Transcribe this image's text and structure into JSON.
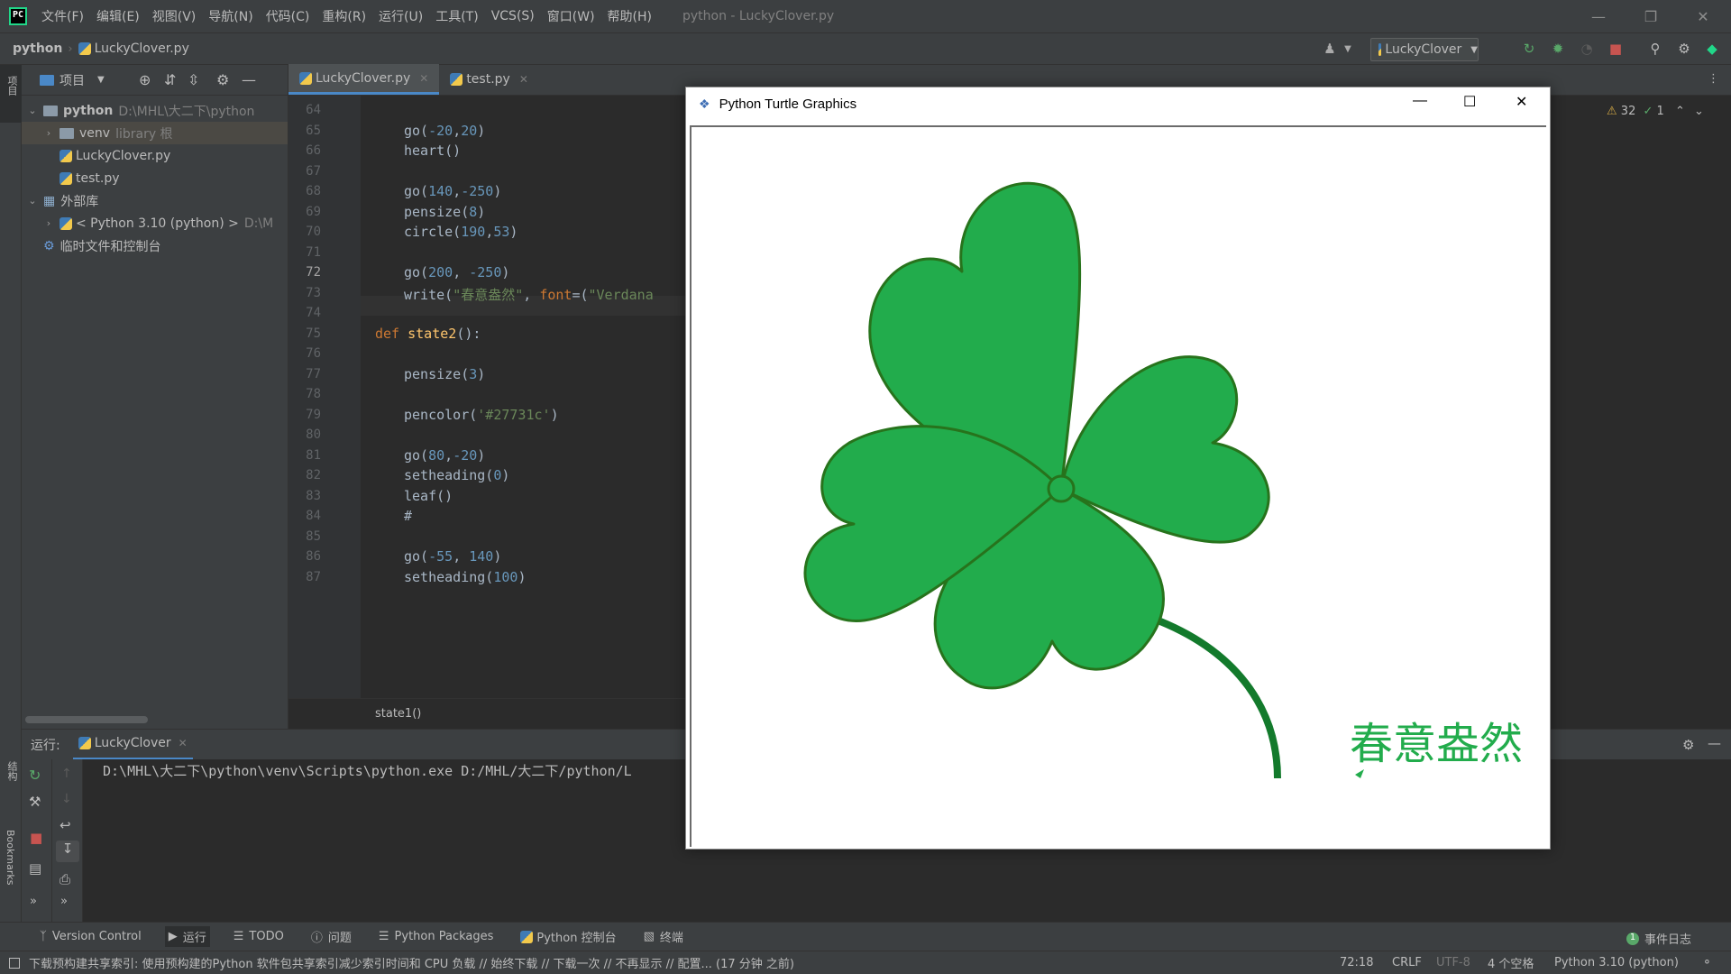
{
  "menubar": {
    "items": [
      "文件(F)",
      "编辑(E)",
      "视图(V)",
      "导航(N)",
      "代码(C)",
      "重构(R)",
      "运行(U)",
      "工具(T)",
      "VCS(S)",
      "窗口(W)",
      "帮助(H)"
    ],
    "window_title": "python - LuckyClover.py"
  },
  "navbar": {
    "project": "python",
    "file": "LuckyClover.py",
    "run_config": "LuckyClover"
  },
  "project_panel": {
    "title": "项目",
    "root": "python",
    "root_path": "D:\\MHL\\大二下\\python",
    "venv": "venv",
    "venv_note": "library 根",
    "file1": "LuckyClover.py",
    "file2": "test.py",
    "external_libs": "外部库",
    "python_sdk": "< Python 3.10 (python) >",
    "python_sdk_path": "D:\\M",
    "scratches": "临时文件和控制台"
  },
  "editor": {
    "tabs": [
      "LuckyClover.py",
      "test.py"
    ],
    "breadcrumb": "state1()",
    "inspections": {
      "warnings": "32",
      "ok": "1"
    },
    "lines": [
      {
        "n": "64",
        "code": ""
      },
      {
        "n": "65",
        "code": "go(-20,20)"
      },
      {
        "n": "66",
        "code": "heart()"
      },
      {
        "n": "67",
        "code": ""
      },
      {
        "n": "68",
        "code": "go(140,-250)"
      },
      {
        "n": "69",
        "code": "pensize(8)"
      },
      {
        "n": "70",
        "code": "circle(190,53)"
      },
      {
        "n": "71",
        "code": ""
      },
      {
        "n": "72",
        "code": "go(200, -250)"
      },
      {
        "n": "73",
        "code": "write(\"春意盎然\", font=(\"Verdana"
      },
      {
        "n": "74",
        "code": ""
      },
      {
        "n": "75",
        "code": "def state2():"
      },
      {
        "n": "76",
        "code": ""
      },
      {
        "n": "77",
        "code": "pensize(3)"
      },
      {
        "n": "78",
        "code": ""
      },
      {
        "n": "79",
        "code": "pencolor('#27731c')"
      },
      {
        "n": "80",
        "code": ""
      },
      {
        "n": "81",
        "code": "go(80,-20)"
      },
      {
        "n": "82",
        "code": "setheading(0)"
      },
      {
        "n": "83",
        "code": "leaf()"
      },
      {
        "n": "84",
        "code": "#"
      },
      {
        "n": "85",
        "code": ""
      },
      {
        "n": "86",
        "code": "go(-55, 140)"
      },
      {
        "n": "87",
        "code": "setheading(100)"
      }
    ]
  },
  "run_panel": {
    "label": "运行:",
    "tab": "LuckyClover",
    "console": "D:\\MHL\\大二下\\python\\venv\\Scripts\\python.exe D:/MHL/大二下/python/L"
  },
  "left_strip": {
    "project": "项目",
    "structure": "结构",
    "bookmarks": "Bookmarks"
  },
  "bottom_tools": {
    "items": [
      "Version Control",
      "运行",
      "TODO",
      "问题",
      "Python Packages",
      "Python 控制台",
      "终端"
    ],
    "event_log": "事件日志"
  },
  "status_bar": {
    "message": "下载预构建共享索引: 使用预构建的Python 软件包共享索引减少索引时间和 CPU 负载 // 始终下载 // 下载一次 // 不再显示 // 配置... (17 分钟 之前)",
    "position": "72:18",
    "line_sep": "CRLF",
    "encoding": "UTF-8",
    "indent": "4 个空格",
    "interpreter": "Python 3.10 (python)"
  },
  "turtle_window": {
    "title": "Python Turtle Graphics",
    "text": "春意盎然"
  },
  "colors": {
    "leaf_fill": "#22ac4c",
    "leaf_outline": "#27731c",
    "stem": "#137a2c",
    "accent": "#4a88c7"
  }
}
